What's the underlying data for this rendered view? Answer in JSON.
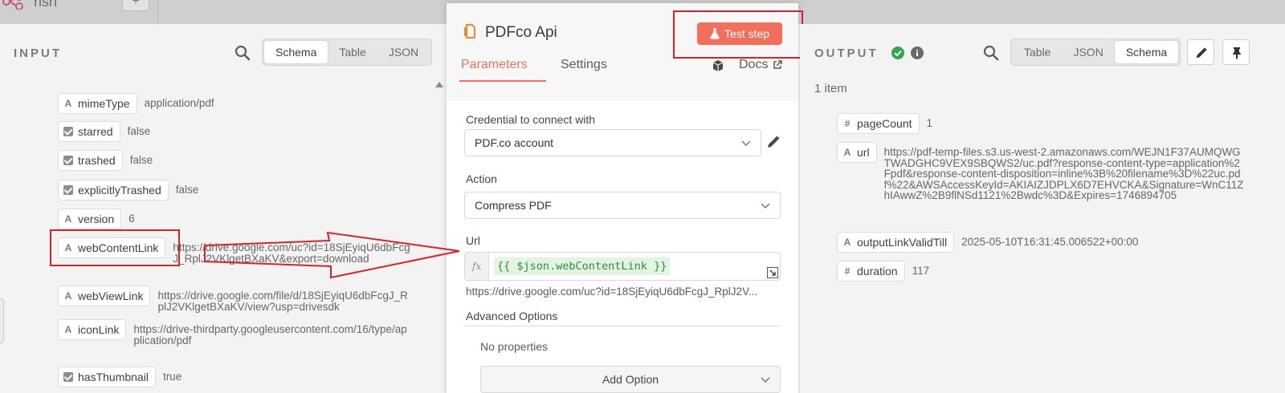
{
  "app": {
    "workflow_name": "rish"
  },
  "input_panel": {
    "title": "INPUT",
    "tabs": [
      {
        "label": "Schema",
        "active": true
      },
      {
        "label": "Table",
        "active": false
      },
      {
        "label": "JSON",
        "active": false
      }
    ],
    "fields": [
      {
        "type": "string",
        "name": "mimeType",
        "value": "application/pdf"
      },
      {
        "type": "boolean",
        "name": "starred",
        "value": "false"
      },
      {
        "type": "boolean",
        "name": "trashed",
        "value": "false"
      },
      {
        "type": "boolean",
        "name": "explicitlyTrashed",
        "value": "false"
      },
      {
        "type": "string",
        "name": "version",
        "value": "6"
      },
      {
        "type": "string",
        "name": "webContentLink",
        "value": "https://drive.google.com/uc?id=18SjEyiqU6dbFcgJ_RplJ2VKlgetBXaKV&export=download"
      },
      {
        "type": "string",
        "name": "webViewLink",
        "value": "https://drive.google.com/file/d/18SjEyiqU6dbFcgJ_RplJ2VKlgetBXaKV/view?usp=drivesdk"
      },
      {
        "type": "string",
        "name": "iconLink",
        "value": "https://drive-thirdparty.googleusercontent.com/16/type/application/pdf"
      },
      {
        "type": "boolean",
        "name": "hasThumbnail",
        "value": "true"
      }
    ]
  },
  "node": {
    "title": "PDFco Api",
    "test_button": "Test step",
    "tabs": {
      "parameters": "Parameters",
      "settings": "Settings",
      "docs": "Docs"
    },
    "credential": {
      "label": "Credential to connect with",
      "value": "PDF.co account"
    },
    "action": {
      "label": "Action",
      "value": "Compress PDF"
    },
    "url": {
      "label": "Url",
      "fx": "fx",
      "expression": "{{ $json.webContentLink }}",
      "preview": "https://drive.google.com/uc?id=18SjEyiqU6dbFcgJ_RplJ2V..."
    },
    "advanced": {
      "title": "Advanced Options",
      "empty": "No properties",
      "add_button": "Add Option"
    }
  },
  "output_panel": {
    "title": "OUTPUT",
    "tabs": [
      {
        "label": "Table",
        "active": false
      },
      {
        "label": "JSON",
        "active": false
      },
      {
        "label": "Schema",
        "active": true
      }
    ],
    "count": "1 item",
    "fields": [
      {
        "type": "number",
        "name": "pageCount",
        "value": "1"
      },
      {
        "type": "string",
        "name": "url",
        "value": "https://pdf-temp-files.s3.us-west-2.amazonaws.com/WEJN1F37AUMQWGTWADGHC9VEX9SBQWS2/uc.pdf?response-content-type=application%2Fpdf&response-content-disposition=inline%3B%20filename%3D%22uc.pdf%22&AWSAccessKeyId=AKIAIZJDPLX6D7EHVCKA&Signature=WnC11ZhIAwwZ%2B9flNSd1121%2Bwdc%3D&Expires=1746894705"
      },
      {
        "type": "string",
        "name": "outputLinkValidTill",
        "value": "2025-05-10T16:31:45.006522+00:00"
      },
      {
        "type": "number",
        "name": "duration",
        "value": "117"
      }
    ]
  },
  "colors": {
    "accent": "#f36f5c",
    "annotation": "#d8232a",
    "success": "#2fa652",
    "expression_bg": "#e3f4e3"
  }
}
